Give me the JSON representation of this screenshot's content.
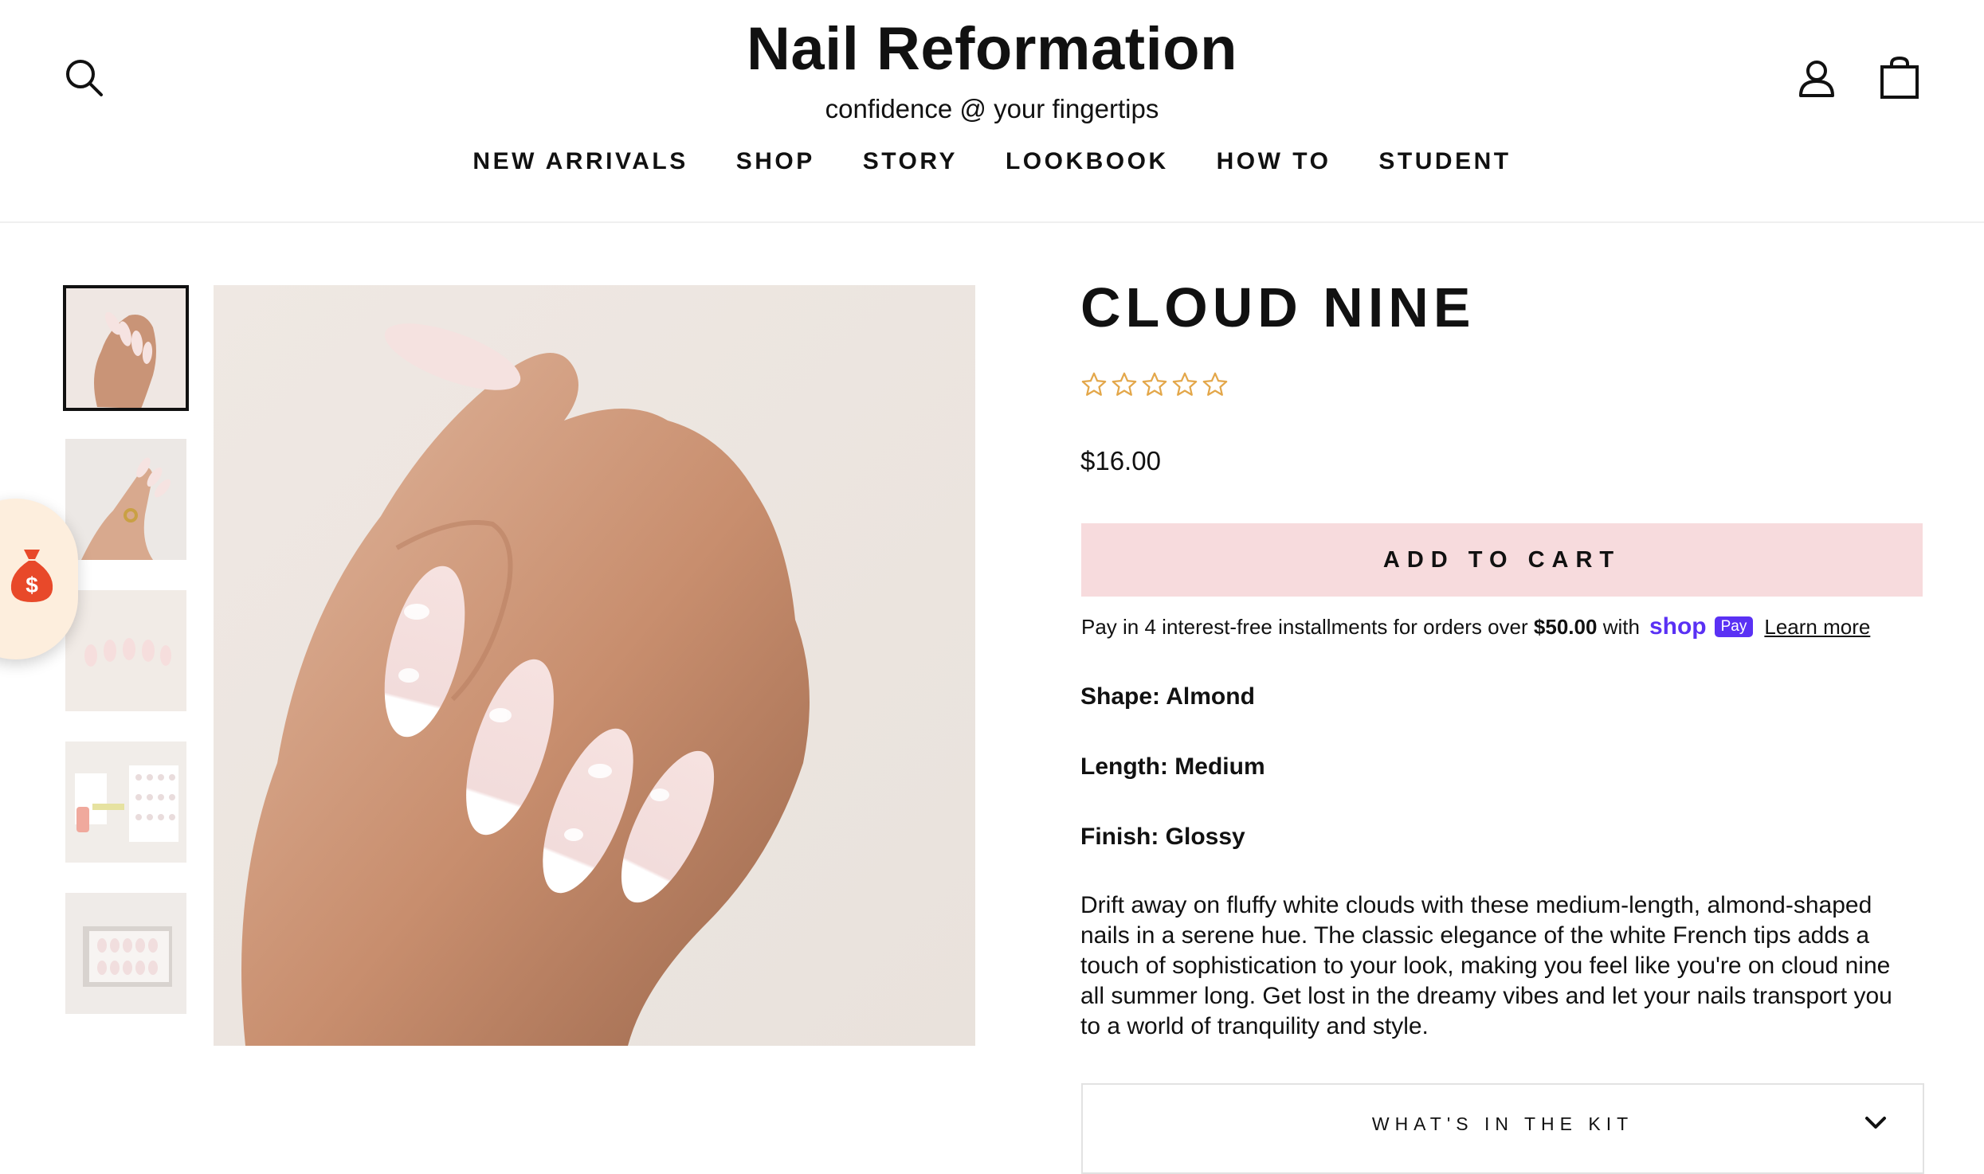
{
  "header": {
    "brand": "Nail Reformation",
    "tagline": "confidence @ your fingertips",
    "icons": [
      "search-icon",
      "account-icon",
      "cart-icon"
    ],
    "nav": [
      "NEW ARRIVALS",
      "SHOP",
      "STORY",
      "LOOKBOOK",
      "HOW TO",
      "STUDENT"
    ]
  },
  "gallery": {
    "thumbnails": [
      "hand-wearing-nails",
      "hand-with-ring",
      "nail-set-on-surface",
      "kit-contents",
      "nail-box"
    ],
    "active_index": 0
  },
  "rewards": {
    "icon": "money-bag-icon",
    "color": "#e8492a"
  },
  "product": {
    "title": "CLOUD NINE",
    "rating": 0,
    "rating_max": 5,
    "price": "$16.00",
    "add_to_cart": "ADD TO CART",
    "installments": {
      "text_before": "Pay in 4 interest-free installments for orders over",
      "amount": "$50.00",
      "text_after": "with",
      "shop": "shop",
      "pay": "Pay",
      "learn_more": "Learn more"
    },
    "specs": {
      "shape": "Shape: Almond",
      "length": "Length: Medium",
      "finish": "Finish: Glossy"
    },
    "description": "Drift away on fluffy white clouds with these medium-length, almond-shaped nails in a serene hue. The classic elegance of the white French tips adds a touch of sophistication to your look, making you feel like you're on cloud nine all summer long. Get lost in the dreamy vibes and let your nails transport you to a world of tranquility and style.",
    "accordion_label": "WHAT'S IN THE KIT"
  },
  "colors": {
    "accent_button": "#f7dbdd",
    "star": "#e3a74a",
    "shop_pay": "#5a31f4"
  }
}
